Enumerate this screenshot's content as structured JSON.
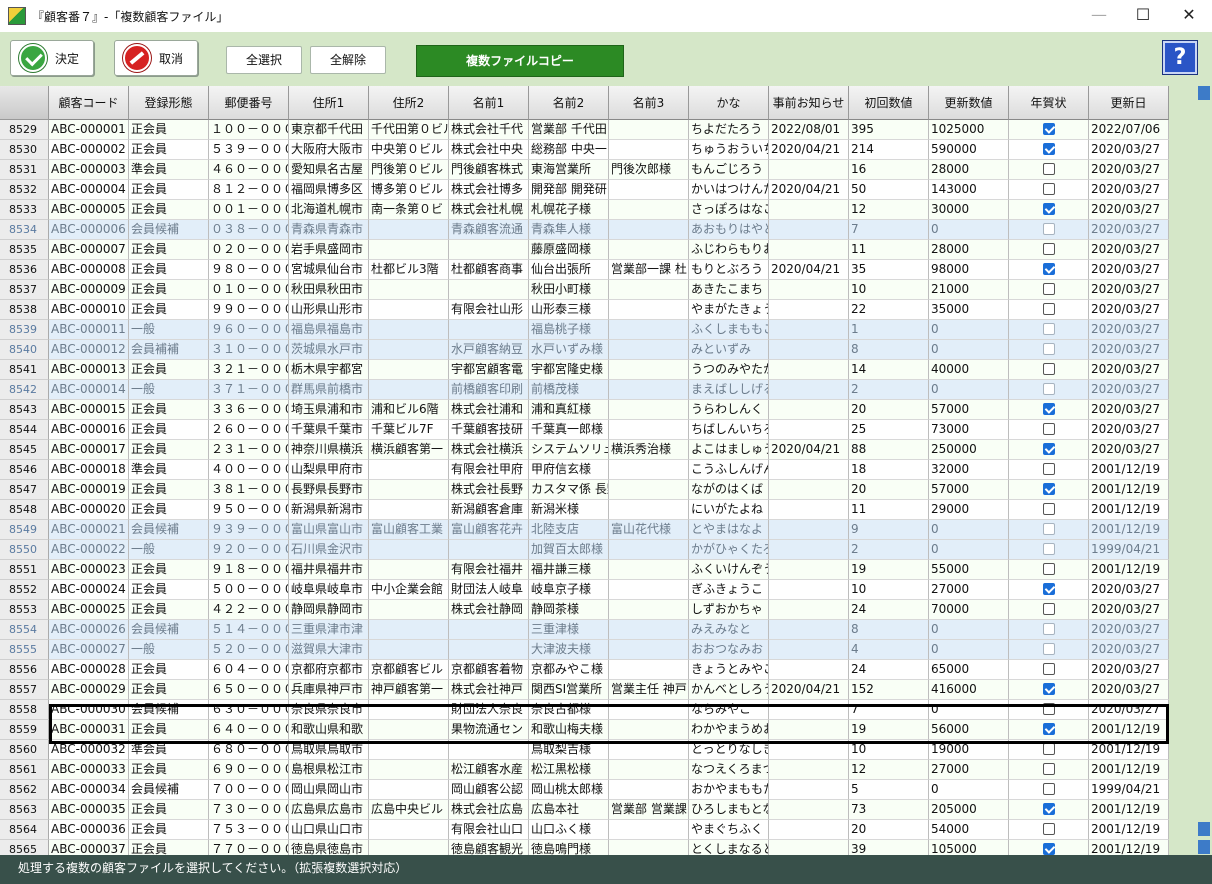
{
  "window": {
    "title": "『顧客番７』-「複数顧客ファイル」",
    "minimize": "—",
    "maximize": "☐",
    "close": "✕"
  },
  "toolbar": {
    "ok_label": "決定",
    "cancel_label": "取消",
    "select_all_label": "全選択",
    "deselect_all_label": "全解除",
    "copy_label": "複数ファイルコピー",
    "help_label": "?"
  },
  "columns": [
    "顧客コード",
    "登録形態",
    "郵便番号",
    "住所1",
    "住所2",
    "名前1",
    "名前2",
    "名前3",
    "かな",
    "事前お知らせ",
    "初回数値",
    "更新数値",
    "年賀状",
    "更新日"
  ],
  "rows": [
    {
      "no": "8529",
      "code": "ABC-000001",
      "type": "正会員",
      "zip": "１００－０００１",
      "addr1": "東京都千代田",
      "addr2": "千代田第０ビル",
      "name1": "株式会社千代",
      "name2": "営業部 千代田",
      "name3": "",
      "kana": "ちよだたろう",
      "notice": "2022/08/01",
      "first": "395",
      "update": "1025000",
      "nenga": true,
      "date": "2022/07/06",
      "dim": false
    },
    {
      "no": "8530",
      "code": "ABC-000002",
      "type": "正会員",
      "zip": "５３９－００００",
      "addr1": "大阪府大阪市",
      "addr2": "中央第０ビル",
      "name1": "株式会社中央",
      "name2": "総務部 中央一",
      "name3": "",
      "kana": "ちゅうおういちろ",
      "notice": "2020/04/21",
      "first": "214",
      "update": "590000",
      "nenga": true,
      "date": "2020/03/27",
      "dim": false
    },
    {
      "no": "8531",
      "code": "ABC-000003",
      "type": "準会員",
      "zip": "４６０－００００",
      "addr1": "愛知県名古屋",
      "addr2": "門後第０ビル",
      "name1": "門後顧客株式",
      "name2": "東海営業所",
      "name3": "門後次郎様",
      "kana": "もんごじろう",
      "notice": "",
      "first": "16",
      "update": "28000",
      "nenga": false,
      "date": "2020/03/27",
      "dim": false
    },
    {
      "no": "8532",
      "code": "ABC-000004",
      "type": "正会員",
      "zip": "８１２－００００",
      "addr1": "福岡県博多区",
      "addr2": "博多第０ビル",
      "name1": "株式会社博多",
      "name2": "開発部 開発研",
      "name3": "",
      "kana": "かいはつけんた",
      "notice": "2020/04/21",
      "first": "50",
      "update": "143000",
      "nenga": false,
      "date": "2020/03/27",
      "dim": false
    },
    {
      "no": "8533",
      "code": "ABC-000005",
      "type": "正会員",
      "zip": "００１－００００",
      "addr1": "北海道札幌市",
      "addr2": "南一条第０ビ",
      "name1": "株式会社札幌",
      "name2": "札幌花子様",
      "name3": "",
      "kana": "さっぽろはなこ",
      "notice": "",
      "first": "12",
      "update": "30000",
      "nenga": true,
      "date": "2020/03/27",
      "dim": false
    },
    {
      "no": "8534",
      "code": "ABC-000006",
      "type": "会員候補",
      "zip": "０３８－００００",
      "addr1": "青森県青森市",
      "addr2": "",
      "name1": "青森顧客流通",
      "name2": "青森隼人様",
      "name3": "",
      "kana": "あおもりはやと",
      "notice": "",
      "first": "7",
      "update": "0",
      "nenga": false,
      "date": "2020/03/27",
      "dim": true
    },
    {
      "no": "8535",
      "code": "ABC-000007",
      "type": "正会員",
      "zip": "０２０－００００",
      "addr1": "岩手県盛岡市",
      "addr2": "",
      "name1": "",
      "name2": "藤原盛岡様",
      "name3": "",
      "kana": "ふじわらもりおか",
      "notice": "",
      "first": "11",
      "update": "28000",
      "nenga": false,
      "date": "2020/03/27",
      "dim": false
    },
    {
      "no": "8536",
      "code": "ABC-000008",
      "type": "正会員",
      "zip": "９８０－００００",
      "addr1": "宮城県仙台市",
      "addr2": "杜都ビル3階",
      "name1": "杜都顧客商事",
      "name2": "仙台出張所",
      "name3": "営業部一課 杜",
      "kana": "もりとぶろう",
      "notice": "2020/04/21",
      "first": "35",
      "update": "98000",
      "nenga": true,
      "date": "2020/03/27",
      "dim": false
    },
    {
      "no": "8537",
      "code": "ABC-000009",
      "type": "正会員",
      "zip": "０１０－００００",
      "addr1": "秋田県秋田市",
      "addr2": "",
      "name1": "",
      "name2": "秋田小町様",
      "name3": "",
      "kana": "あきたこまち",
      "notice": "",
      "first": "10",
      "update": "21000",
      "nenga": false,
      "date": "2020/03/27",
      "dim": false
    },
    {
      "no": "8538",
      "code": "ABC-000010",
      "type": "正会員",
      "zip": "９９０－００００",
      "addr1": "山形県山形市",
      "addr2": "",
      "name1": "有限会社山形",
      "name2": "山形泰三様",
      "name3": "",
      "kana": "やまがたきょうぞ",
      "notice": "",
      "first": "22",
      "update": "35000",
      "nenga": false,
      "date": "2020/03/27",
      "dim": false
    },
    {
      "no": "8539",
      "code": "ABC-000011",
      "type": "一般",
      "zip": "９６０－００００",
      "addr1": "福島県福島市",
      "addr2": "",
      "name1": "",
      "name2": "福島桃子様",
      "name3": "",
      "kana": "ふくしまももこ",
      "notice": "",
      "first": "1",
      "update": "0",
      "nenga": false,
      "date": "2020/03/27",
      "dim": true
    },
    {
      "no": "8540",
      "code": "ABC-000012",
      "type": "会員補補",
      "zip": "３１０－００００",
      "addr1": "茨城県水戸市",
      "addr2": "",
      "name1": "水戸顧客納豆",
      "name2": "水戸いずみ様",
      "name3": "",
      "kana": "みといずみ",
      "notice": "",
      "first": "8",
      "update": "0",
      "nenga": false,
      "date": "2020/03/27",
      "dim": true
    },
    {
      "no": "8541",
      "code": "ABC-000013",
      "type": "正会員",
      "zip": "３２１－００００",
      "addr1": "栃木県宇都宮",
      "addr2": "",
      "name1": "宇都宮顧客電",
      "name2": "宇都宮隆史様",
      "name3": "",
      "kana": "うつのみやたかし",
      "notice": "",
      "first": "14",
      "update": "40000",
      "nenga": false,
      "date": "2020/03/27",
      "dim": false
    },
    {
      "no": "8542",
      "code": "ABC-000014",
      "type": "一般",
      "zip": "３７１－００００",
      "addr1": "群馬県前橋市",
      "addr2": "",
      "name1": "前橋顧客印刷",
      "name2": "前橋茂様",
      "name3": "",
      "kana": "まえばししげる",
      "notice": "",
      "first": "2",
      "update": "0",
      "nenga": false,
      "date": "2020/03/27",
      "dim": true
    },
    {
      "no": "8543",
      "code": "ABC-000015",
      "type": "正会員",
      "zip": "３３６－００００",
      "addr1": "埼玉県浦和市",
      "addr2": "浦和ビル6階",
      "name1": "株式会社浦和",
      "name2": "浦和真紅様",
      "name3": "",
      "kana": "うらわしんく",
      "notice": "",
      "first": "20",
      "update": "57000",
      "nenga": true,
      "date": "2020/03/27",
      "dim": false
    },
    {
      "no": "8544",
      "code": "ABC-000016",
      "type": "正会員",
      "zip": "２６０－００００",
      "addr1": "千葉県千葉市",
      "addr2": "千葉ビル7F",
      "name1": "千葉顧客技研",
      "name2": "千葉真一郎様",
      "name3": "",
      "kana": "ちばしんいちろう",
      "notice": "",
      "first": "25",
      "update": "73000",
      "nenga": false,
      "date": "2020/03/27",
      "dim": false
    },
    {
      "no": "8545",
      "code": "ABC-000017",
      "type": "正会員",
      "zip": "２３１－００００",
      "addr1": "神奈川県横浜",
      "addr2": "横浜顧客第一",
      "name1": "株式会社横浜",
      "name2": "システムソリュー",
      "name3": "横浜秀治様",
      "kana": "よこはましゅうじ",
      "notice": "2020/04/21",
      "first": "88",
      "update": "250000",
      "nenga": true,
      "date": "2020/03/27",
      "dim": false
    },
    {
      "no": "8546",
      "code": "ABC-000018",
      "type": "準会員",
      "zip": "４００－００００",
      "addr1": "山梨県甲府市",
      "addr2": "",
      "name1": "有限会社甲府",
      "name2": "甲府信玄様",
      "name3": "",
      "kana": "こうふしんげん",
      "notice": "",
      "first": "18",
      "update": "32000",
      "nenga": false,
      "date": "2001/12/19",
      "dim": false
    },
    {
      "no": "8547",
      "code": "ABC-000019",
      "type": "正会員",
      "zip": "３８１－００００",
      "addr1": "長野県長野市",
      "addr2": "",
      "name1": "株式会社長野",
      "name2": "カスタマ係 長野",
      "name3": "",
      "kana": "ながのはくば",
      "notice": "",
      "first": "20",
      "update": "57000",
      "nenga": true,
      "date": "2001/12/19",
      "dim": false
    },
    {
      "no": "8548",
      "code": "ABC-000020",
      "type": "正会員",
      "zip": "９５０－００００",
      "addr1": "新潟県新潟市",
      "addr2": "",
      "name1": "新潟顧客倉庫",
      "name2": "新潟米様",
      "name3": "",
      "kana": "にいがたよね",
      "notice": "",
      "first": "11",
      "update": "29000",
      "nenga": false,
      "date": "2001/12/19",
      "dim": false
    },
    {
      "no": "8549",
      "code": "ABC-000021",
      "type": "会員候補",
      "zip": "９３９－００００",
      "addr1": "富山県富山市",
      "addr2": "富山顧客工業",
      "name1": "富山顧客花卉",
      "name2": "北陸支店",
      "name3": "富山花代様",
      "kana": "とやまはなよ",
      "notice": "",
      "first": "9",
      "update": "0",
      "nenga": false,
      "date": "2001/12/19",
      "dim": true
    },
    {
      "no": "8550",
      "code": "ABC-000022",
      "type": "一般",
      "zip": "９２０－００００",
      "addr1": "石川県金沢市",
      "addr2": "",
      "name1": "",
      "name2": "加賀百太郎様",
      "name3": "",
      "kana": "かがひゃくたろう",
      "notice": "",
      "first": "2",
      "update": "0",
      "nenga": false,
      "date": "1999/04/21",
      "dim": true
    },
    {
      "no": "8551",
      "code": "ABC-000023",
      "type": "正会員",
      "zip": "９１８－００００",
      "addr1": "福井県福井市",
      "addr2": "",
      "name1": "有限会社福井",
      "name2": "福井謙三様",
      "name3": "",
      "kana": "ふくいけんぞう",
      "notice": "",
      "first": "19",
      "update": "55000",
      "nenga": false,
      "date": "2001/12/19",
      "dim": false
    },
    {
      "no": "8552",
      "code": "ABC-000024",
      "type": "正会員",
      "zip": "５００－００００",
      "addr1": "岐阜県岐阜市",
      "addr2": "中小企業会館",
      "name1": "財団法人岐阜",
      "name2": "岐阜京子様",
      "name3": "",
      "kana": "ぎふきょうこ",
      "notice": "",
      "first": "10",
      "update": "27000",
      "nenga": true,
      "date": "2020/03/27",
      "dim": false
    },
    {
      "no": "8553",
      "code": "ABC-000025",
      "type": "正会員",
      "zip": "４２２－００００",
      "addr1": "静岡県静岡市",
      "addr2": "",
      "name1": "株式会社静岡",
      "name2": "静岡茶様",
      "name3": "",
      "kana": "しずおかちゃ",
      "notice": "",
      "first": "24",
      "update": "70000",
      "nenga": false,
      "date": "2020/03/27",
      "dim": false
    },
    {
      "no": "8554",
      "code": "ABC-000026",
      "type": "会員候補",
      "zip": "５１４－００００",
      "addr1": "三重県津市津",
      "addr2": "",
      "name1": "",
      "name2": "三重津様",
      "name3": "",
      "kana": "みえみなと",
      "notice": "",
      "first": "8",
      "update": "0",
      "nenga": false,
      "date": "2020/03/27",
      "dim": true
    },
    {
      "no": "8555",
      "code": "ABC-000027",
      "type": "一般",
      "zip": "５２０－００００",
      "addr1": "滋賀県大津市",
      "addr2": "",
      "name1": "",
      "name2": "大津波夫様",
      "name3": "",
      "kana": "おおつなみお",
      "notice": "",
      "first": "4",
      "update": "0",
      "nenga": false,
      "date": "2020/03/27",
      "dim": true
    },
    {
      "no": "8556",
      "code": "ABC-000028",
      "type": "正会員",
      "zip": "６０４－００００",
      "addr1": "京都府京都市",
      "addr2": "京都顧客ビル",
      "name1": "京都顧客着物",
      "name2": "京都みやこ様",
      "name3": "",
      "kana": "きょうとみやこ",
      "notice": "",
      "first": "24",
      "update": "65000",
      "nenga": false,
      "date": "2020/03/27",
      "dim": false
    },
    {
      "no": "8557",
      "code": "ABC-000029",
      "type": "正会員",
      "zip": "６５０－００００",
      "addr1": "兵庫県神戸市",
      "addr2": "神戸顧客第一",
      "name1": "株式会社神戸",
      "name2": "関西SI営業所",
      "name3": "営業主任 神戸",
      "kana": "かんべとしろう",
      "notice": "2020/04/21",
      "first": "152",
      "update": "416000",
      "nenga": true,
      "date": "2020/03/27",
      "dim": false
    },
    {
      "no": "8558",
      "code": "ABC-000030",
      "type": "会員候補",
      "zip": "６３０－００００",
      "addr1": "奈良県奈良市",
      "addr2": "",
      "name1": "財団法人奈良",
      "name2": "奈良古都様",
      "name3": "",
      "kana": "ならみやこ",
      "notice": "",
      "first": "7",
      "update": "0",
      "nenga": false,
      "date": "2020/03/27",
      "dim": false
    },
    {
      "no": "8559",
      "code": "ABC-000031",
      "type": "正会員",
      "zip": "６４０－００００",
      "addr1": "和歌山県和歌",
      "addr2": "",
      "name1": "果物流通セン",
      "name2": "和歌山梅夫様",
      "name3": "",
      "kana": "わかやまうめお",
      "notice": "",
      "first": "19",
      "update": "56000",
      "nenga": true,
      "date": "2001/12/19",
      "dim": false
    },
    {
      "no": "8560",
      "code": "ABC-000032",
      "type": "準会員",
      "zip": "６８０－００００",
      "addr1": "鳥取県鳥取市",
      "addr2": "",
      "name1": "",
      "name2": "鳥取梨吉様",
      "name3": "",
      "kana": "とっとりなしきち",
      "notice": "",
      "first": "10",
      "update": "19000",
      "nenga": false,
      "date": "2001/12/19",
      "dim": false
    },
    {
      "no": "8561",
      "code": "ABC-000033",
      "type": "正会員",
      "zip": "６９０－００００",
      "addr1": "島根県松江市",
      "addr2": "",
      "name1": "松江顧客水産",
      "name2": "松江黒松様",
      "name3": "",
      "kana": "なつえくろまつ",
      "notice": "",
      "first": "12",
      "update": "27000",
      "nenga": false,
      "date": "2001/12/19",
      "dim": false
    },
    {
      "no": "8562",
      "code": "ABC-000034",
      "type": "会員候補",
      "zip": "７００－００００",
      "addr1": "岡山県岡山市",
      "addr2": "",
      "name1": "岡山顧客公認",
      "name2": "岡山桃太郎様",
      "name3": "",
      "kana": "おかやまももたろ",
      "notice": "",
      "first": "5",
      "update": "0",
      "nenga": false,
      "date": "1999/04/21",
      "dim": false
    },
    {
      "no": "8563",
      "code": "ABC-000035",
      "type": "正会員",
      "zip": "７３０－００００",
      "addr1": "広島県広島市",
      "addr2": "広島中央ビル",
      "name1": "株式会社広島",
      "name2": "広島本社",
      "name3": "営業部 営業課",
      "kana": "ひろしまもとなり",
      "notice": "",
      "first": "73",
      "update": "205000",
      "nenga": true,
      "date": "2001/12/19",
      "dim": false
    },
    {
      "no": "8564",
      "code": "ABC-000036",
      "type": "正会員",
      "zip": "７５３－００００",
      "addr1": "山口県山口市",
      "addr2": "",
      "name1": "有限会社山口",
      "name2": "山口ふく様",
      "name3": "",
      "kana": "やまぐちふく",
      "notice": "",
      "first": "20",
      "update": "54000",
      "nenga": false,
      "date": "2001/12/19",
      "dim": false
    },
    {
      "no": "8565",
      "code": "ABC-000037",
      "type": "正会員",
      "zip": "７７０－００００",
      "addr1": "徳島県徳島市",
      "addr2": "",
      "name1": "徳島顧客観光",
      "name2": "徳島鳴門様",
      "name3": "",
      "kana": "とくしまなると",
      "notice": "",
      "first": "39",
      "update": "105000",
      "nenga": true,
      "date": "2001/12/19",
      "dim": false
    }
  ],
  "status": "処理する複数の顧客ファイルを選択してください。（拡張複数選択対応）"
}
